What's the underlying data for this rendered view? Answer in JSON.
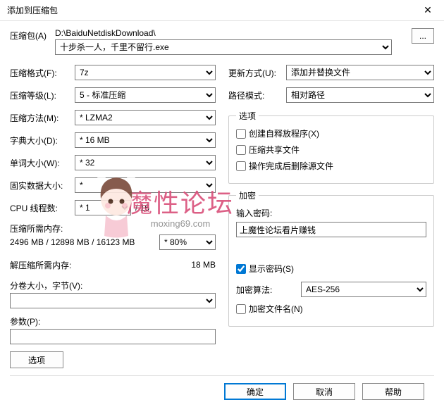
{
  "window": {
    "title": "添加到压缩包",
    "close": "✕"
  },
  "archive": {
    "label": "压缩包(A)",
    "path": "D:\\BaiduNetdiskDownload\\",
    "name": "十步杀一人，千里不留行.exe",
    "browse": "..."
  },
  "left": {
    "format": {
      "label": "压缩格式(F):",
      "value": "7z"
    },
    "level": {
      "label": "压缩等级(L):",
      "value": "5 - 标准压缩"
    },
    "method": {
      "label": "压缩方法(M):",
      "value": "* LZMA2"
    },
    "dict": {
      "label": "字典大小(D):",
      "value": "* 16 MB"
    },
    "word": {
      "label": "单词大小(W):",
      "value": "* 32"
    },
    "solid": {
      "label": "固实数据大小:",
      "value": "*"
    },
    "cpu": {
      "label": "CPU 线程数:",
      "value": "* 1",
      "total": "/ 16"
    },
    "mem_comp_label": "压缩所需内存:",
    "mem_comp_value": "2496 MB / 12898 MB / 16123 MB",
    "mem_comp_pct": "* 80%",
    "mem_decomp_label": "解压缩所需内存:",
    "mem_decomp_value": "18 MB",
    "split": {
      "label": "分卷大小，字节(V):"
    },
    "params": {
      "label": "参数(P):"
    },
    "options_btn": "选项"
  },
  "right": {
    "update": {
      "label": "更新方式(U):",
      "value": "添加并替换文件"
    },
    "pathmode": {
      "label": "路径模式:",
      "value": "相对路径"
    },
    "options_legend": "选项",
    "opt_sfx": "创建自释放程序(X)",
    "opt_shared": "压缩共享文件",
    "opt_delete": "操作完成后删除源文件",
    "enc_legend": "加密",
    "pw_label": "输入密码:",
    "pw_value": "上魔性论坛看片赚钱",
    "show_pw": "显示密码(S)",
    "enc_method_label": "加密算法:",
    "enc_method_value": "AES-256",
    "enc_names": "加密文件名(N)"
  },
  "footer": {
    "ok": "确定",
    "cancel": "取消",
    "help": "帮助"
  },
  "watermark": {
    "text": "魔性论坛",
    "sub": "moxing69.com"
  }
}
